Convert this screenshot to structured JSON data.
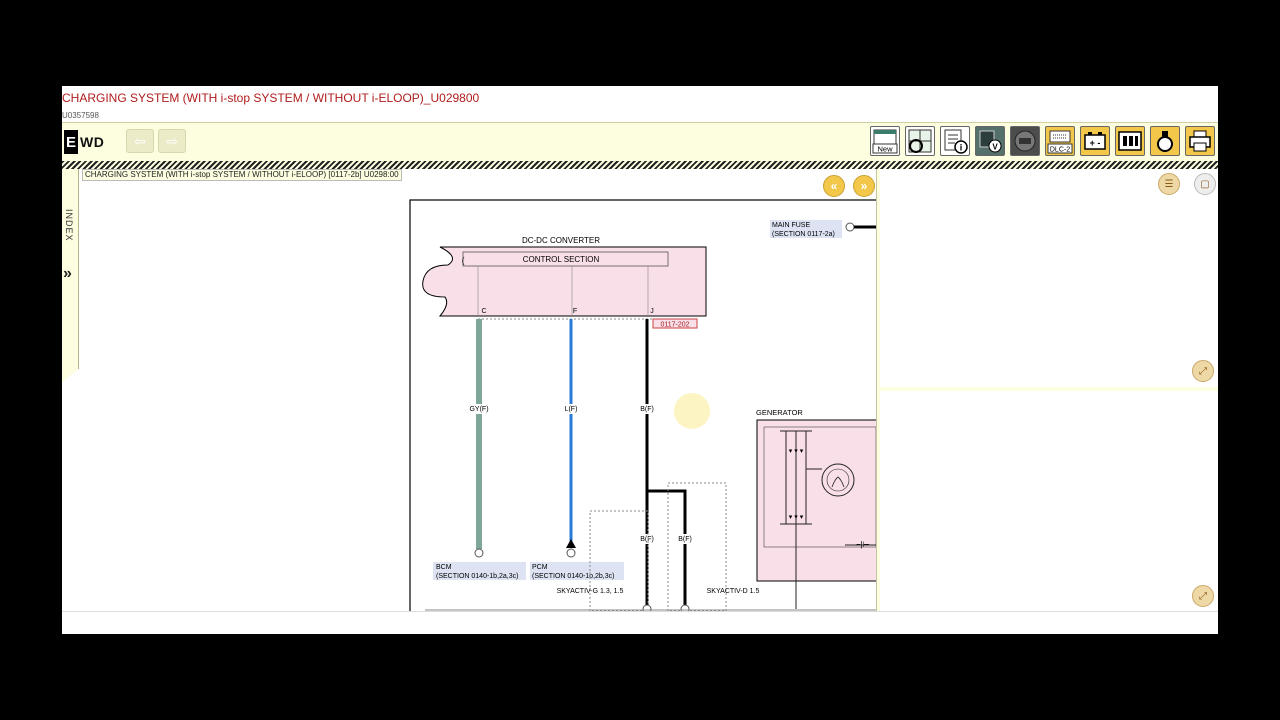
{
  "window": {
    "title": "CHARGING SYSTEM (WITH i-stop SYSTEM / WITHOUT i-ELOOP)_U029800",
    "doc_id": "U0357598"
  },
  "toolbar": {
    "logo_letter": "E",
    "logo_text": "WD",
    "back_label": "⇦",
    "forward_label": "⇨",
    "tools": [
      {
        "name": "new-window-icon",
        "label": "New"
      },
      {
        "name": "refresh-icon",
        "label": ""
      },
      {
        "name": "info-icon",
        "label": ""
      },
      {
        "name": "check-icon",
        "label": ""
      },
      {
        "name": "connector-icon",
        "label": ""
      },
      {
        "name": "dlc-icon",
        "label": "DLC-2"
      },
      {
        "name": "battery-icon",
        "label": "+ -"
      },
      {
        "name": "fuse-box-icon",
        "label": ""
      },
      {
        "name": "bulb-icon",
        "label": ""
      },
      {
        "name": "print-icon",
        "label": ""
      }
    ]
  },
  "sidebar": {
    "index_label": "INDEX",
    "expander": "»"
  },
  "diagram": {
    "header": "CHARGING SYSTEM (WITH i-stop SYSTEM / WITHOUT i-ELOOP) [0117-2b] U0298:00",
    "prev_label": "«",
    "next_label": "»",
    "converter_label": "DC-DC CONVERTER",
    "control_section": "CONTROL SECTION",
    "pin_c": "C",
    "pin_f": "F",
    "pin_j": "J",
    "connector_code": "0117-202",
    "wire1": "GY(F)",
    "wire2": "L(F)",
    "wire3": "B(F)",
    "wire4": "B(F)",
    "wire5": "B(F)",
    "bcm": "BCM",
    "bcm_section": "(SECTION 0140-1b,2a,3c)",
    "pcm": "PCM",
    "pcm_section": "(SECTION 0140-1b,2b,3c)",
    "main_fuse": "MAIN FUSE",
    "main_fuse_section": "(SECTION 0117-2a)",
    "generator": "GENERATOR",
    "skyactiv_g": "SKYACTIV-G 1.3, 1.5",
    "skyactiv_d": "SKYACTIV-D 1.5"
  },
  "panels": {
    "list_icon": "☰",
    "expand_icon": "⤢"
  },
  "colors": {
    "accent_title": "#b01c1c",
    "toolbar_bg": "#fdfde0",
    "component_fill": "#f9dfe8",
    "wire_gray": "#7fa69a",
    "wire_blue": "#2a7ad6",
    "label_highlight": "#dde3f3"
  }
}
